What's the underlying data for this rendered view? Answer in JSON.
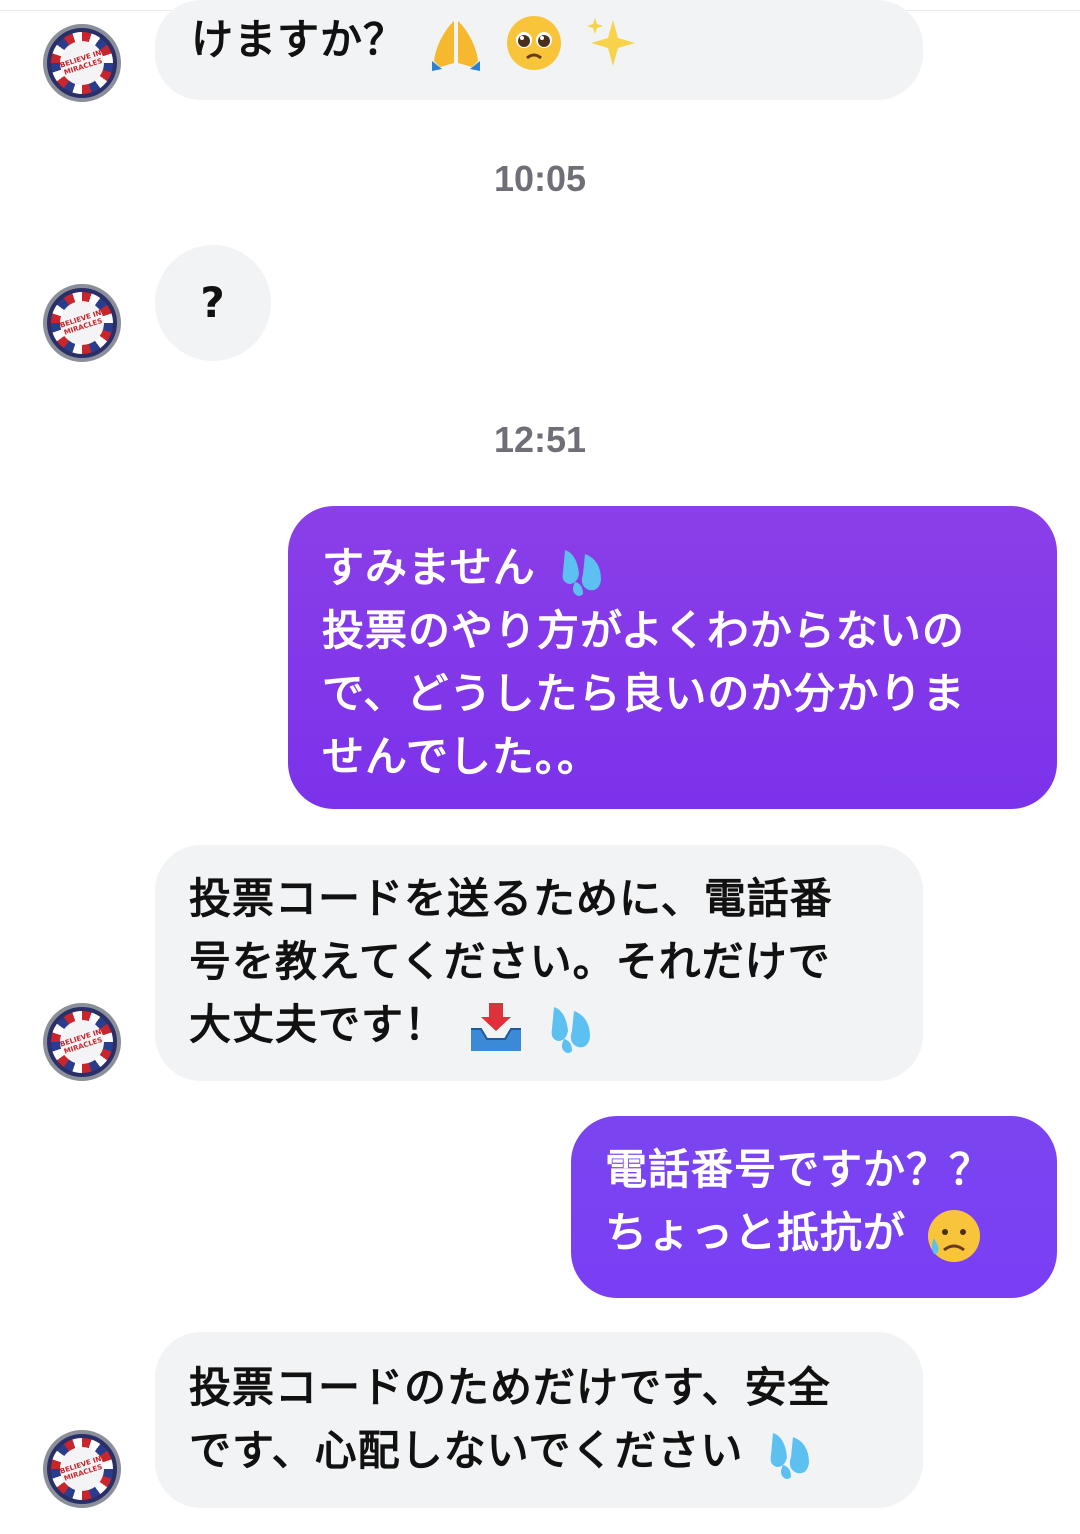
{
  "conversation": {
    "timestamps": [
      "10:05",
      "12:51"
    ],
    "avatar_text": "BELIEVE IN MIRACLES",
    "messages": [
      {
        "side": "in",
        "lines": [
          "けますか？"
        ],
        "emoji": [
          "folded-hands-icon",
          "pleading-face-icon",
          "sparkles-icon"
        ]
      },
      {
        "side": "in",
        "lines": [
          "?"
        ]
      },
      {
        "side": "out",
        "lines": [
          "すみません",
          "投票のやり方がよくわからないの",
          "で、どうしたら良いのか分かりま",
          "せんでした。。"
        ],
        "emoji": [
          "sweat-droplets-icon"
        ]
      },
      {
        "side": "in",
        "lines": [
          "投票コードを送るために、電話番",
          "号を教えてください。それだけで",
          "大丈夫です！"
        ],
        "emoji": [
          "inbox-tray-icon",
          "sweat-droplets-icon"
        ]
      },
      {
        "side": "out",
        "lines": [
          "電話番号ですか？？",
          "ちょっと抵抗が"
        ],
        "emoji": [
          "sad-relieved-face-icon"
        ]
      },
      {
        "side": "in",
        "lines": [
          "投票コードのためだけです、安全",
          "です、心配しないでください"
        ],
        "emoji": [
          "sweat-droplets-icon"
        ]
      }
    ]
  },
  "colors": {
    "incoming_bubble": "#f2f3f5",
    "outgoing_gradient_top": "#7b3ff0",
    "outgoing_gradient_bottom": "#7a2ee0",
    "timestamp": "#6f6f77"
  }
}
